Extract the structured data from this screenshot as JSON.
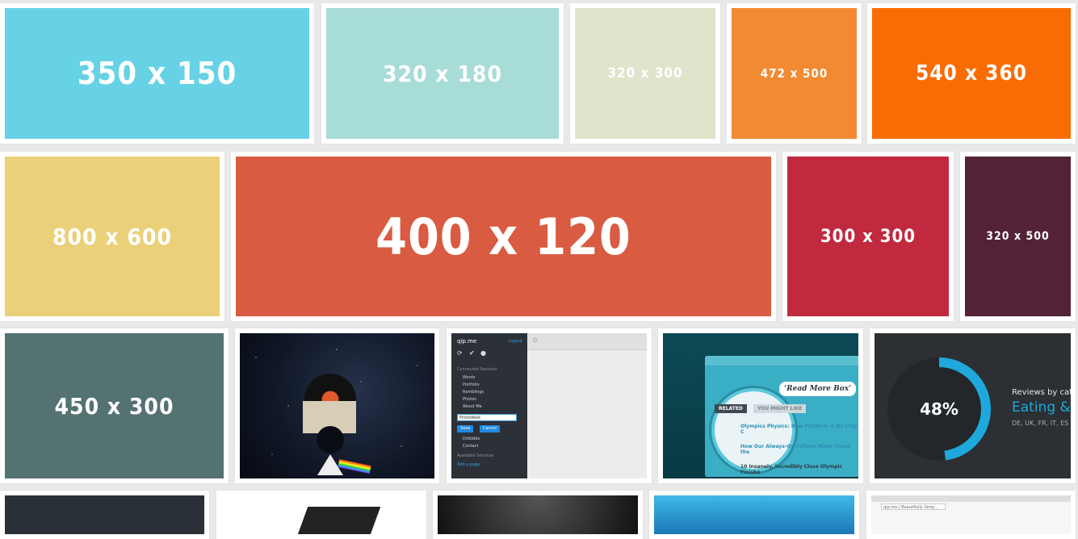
{
  "placeholders": [
    {
      "label": "350 x 150",
      "color": "#67d2e6"
    },
    {
      "label": "320 x 180",
      "color": "#a8dcd7"
    },
    {
      "label": "320 x 300",
      "color": "#e0e4cb"
    },
    {
      "label": "472 x 500",
      "color": "#f28a33"
    },
    {
      "label": "540 x 360",
      "color": "#f96b03"
    },
    {
      "label": "800 x 600",
      "color": "#ebd07a"
    },
    {
      "label": "400 x 120",
      "color": "#d95b42"
    },
    {
      "label": "300 x 300",
      "color": "#c1293f"
    },
    {
      "label": "320 x 500",
      "color": "#532236"
    },
    {
      "label": "450 x 300",
      "color": "#557273"
    }
  ],
  "app": {
    "logo": "qip.me",
    "logout": "Logout",
    "connected_services": "Connected Services",
    "items": [
      "Words",
      "Portfolio",
      "Ramblings",
      "Photos",
      "About Me"
    ],
    "input_value": "PhotoWalk",
    "save": "Save",
    "cancel": "Cancel",
    "items2": [
      "Dribbble",
      "Contact"
    ],
    "available_services": "Available Services",
    "add_page": "Add a page"
  },
  "readmore": {
    "bubble": "‘Read More Box’",
    "tab_related": "RELATED",
    "tab_might": "YOU MIGHT LIKE",
    "lines": [
      "Olympics Physics: New Platform is No Chip C",
      "How Our Always-On Culture Made These the",
      "10 Insanely, Incredibly Close Olympic Finishe"
    ]
  },
  "stats": {
    "percent": "48%",
    "percent_value": 48,
    "heading": "Reviews by cate",
    "category": "Eating &",
    "countries": "DE, UK, FR, IT, ES"
  },
  "browser": {
    "url": "qip.me | Beautifully Simp..."
  }
}
